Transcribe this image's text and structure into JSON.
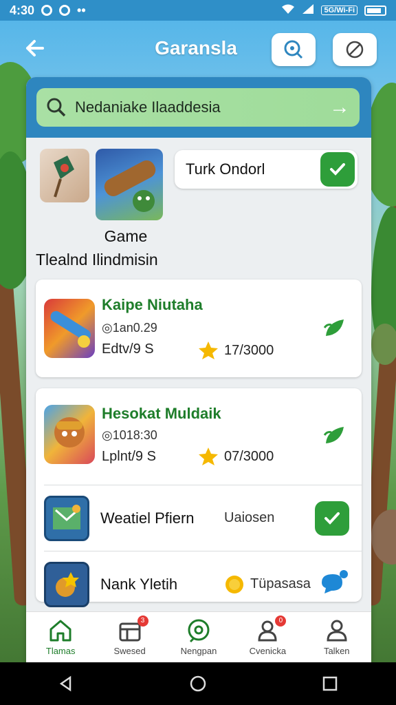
{
  "status_bar": {
    "time": "4:30",
    "tag": "5G/Wi-Fi"
  },
  "app_bar": {
    "title": "Garansla"
  },
  "search": {
    "text": "Nedaniake Ilaaddesia"
  },
  "featured": {
    "title": "Game",
    "subtitle": "Tlealnd Ilindmisin",
    "pill_text": "Turk Ondorl"
  },
  "cards": [
    {
      "name": "Kaipe Niutaha",
      "meta": "◎1an0.29",
      "sub": "Edtv/9 S",
      "rating": "17/3000"
    },
    {
      "name": "Hesokat Muldaik",
      "meta": "◎1018:30",
      "sub": "Lplnt/9 S",
      "rating": "07/3000"
    }
  ],
  "rows": [
    {
      "name": "Weatiel Pfiern",
      "extra": "Uaiosen"
    },
    {
      "name": "Nank Yletih",
      "extra": "Tüpasasa"
    }
  ],
  "bottom_nav": [
    {
      "label": "Tlamas",
      "icon": "home-icon"
    },
    {
      "label": "Swesed",
      "icon": "store-icon",
      "badge": "3"
    },
    {
      "label": "Nengpan",
      "icon": "chat-icon"
    },
    {
      "label": "Cvenicka",
      "icon": "community-icon",
      "badge": "0"
    },
    {
      "label": "Talken",
      "icon": "profile-icon"
    }
  ],
  "colors": {
    "primary": "#2e86bf",
    "accent_green": "#2e9e3a",
    "title_green": "#1e7d2a"
  }
}
